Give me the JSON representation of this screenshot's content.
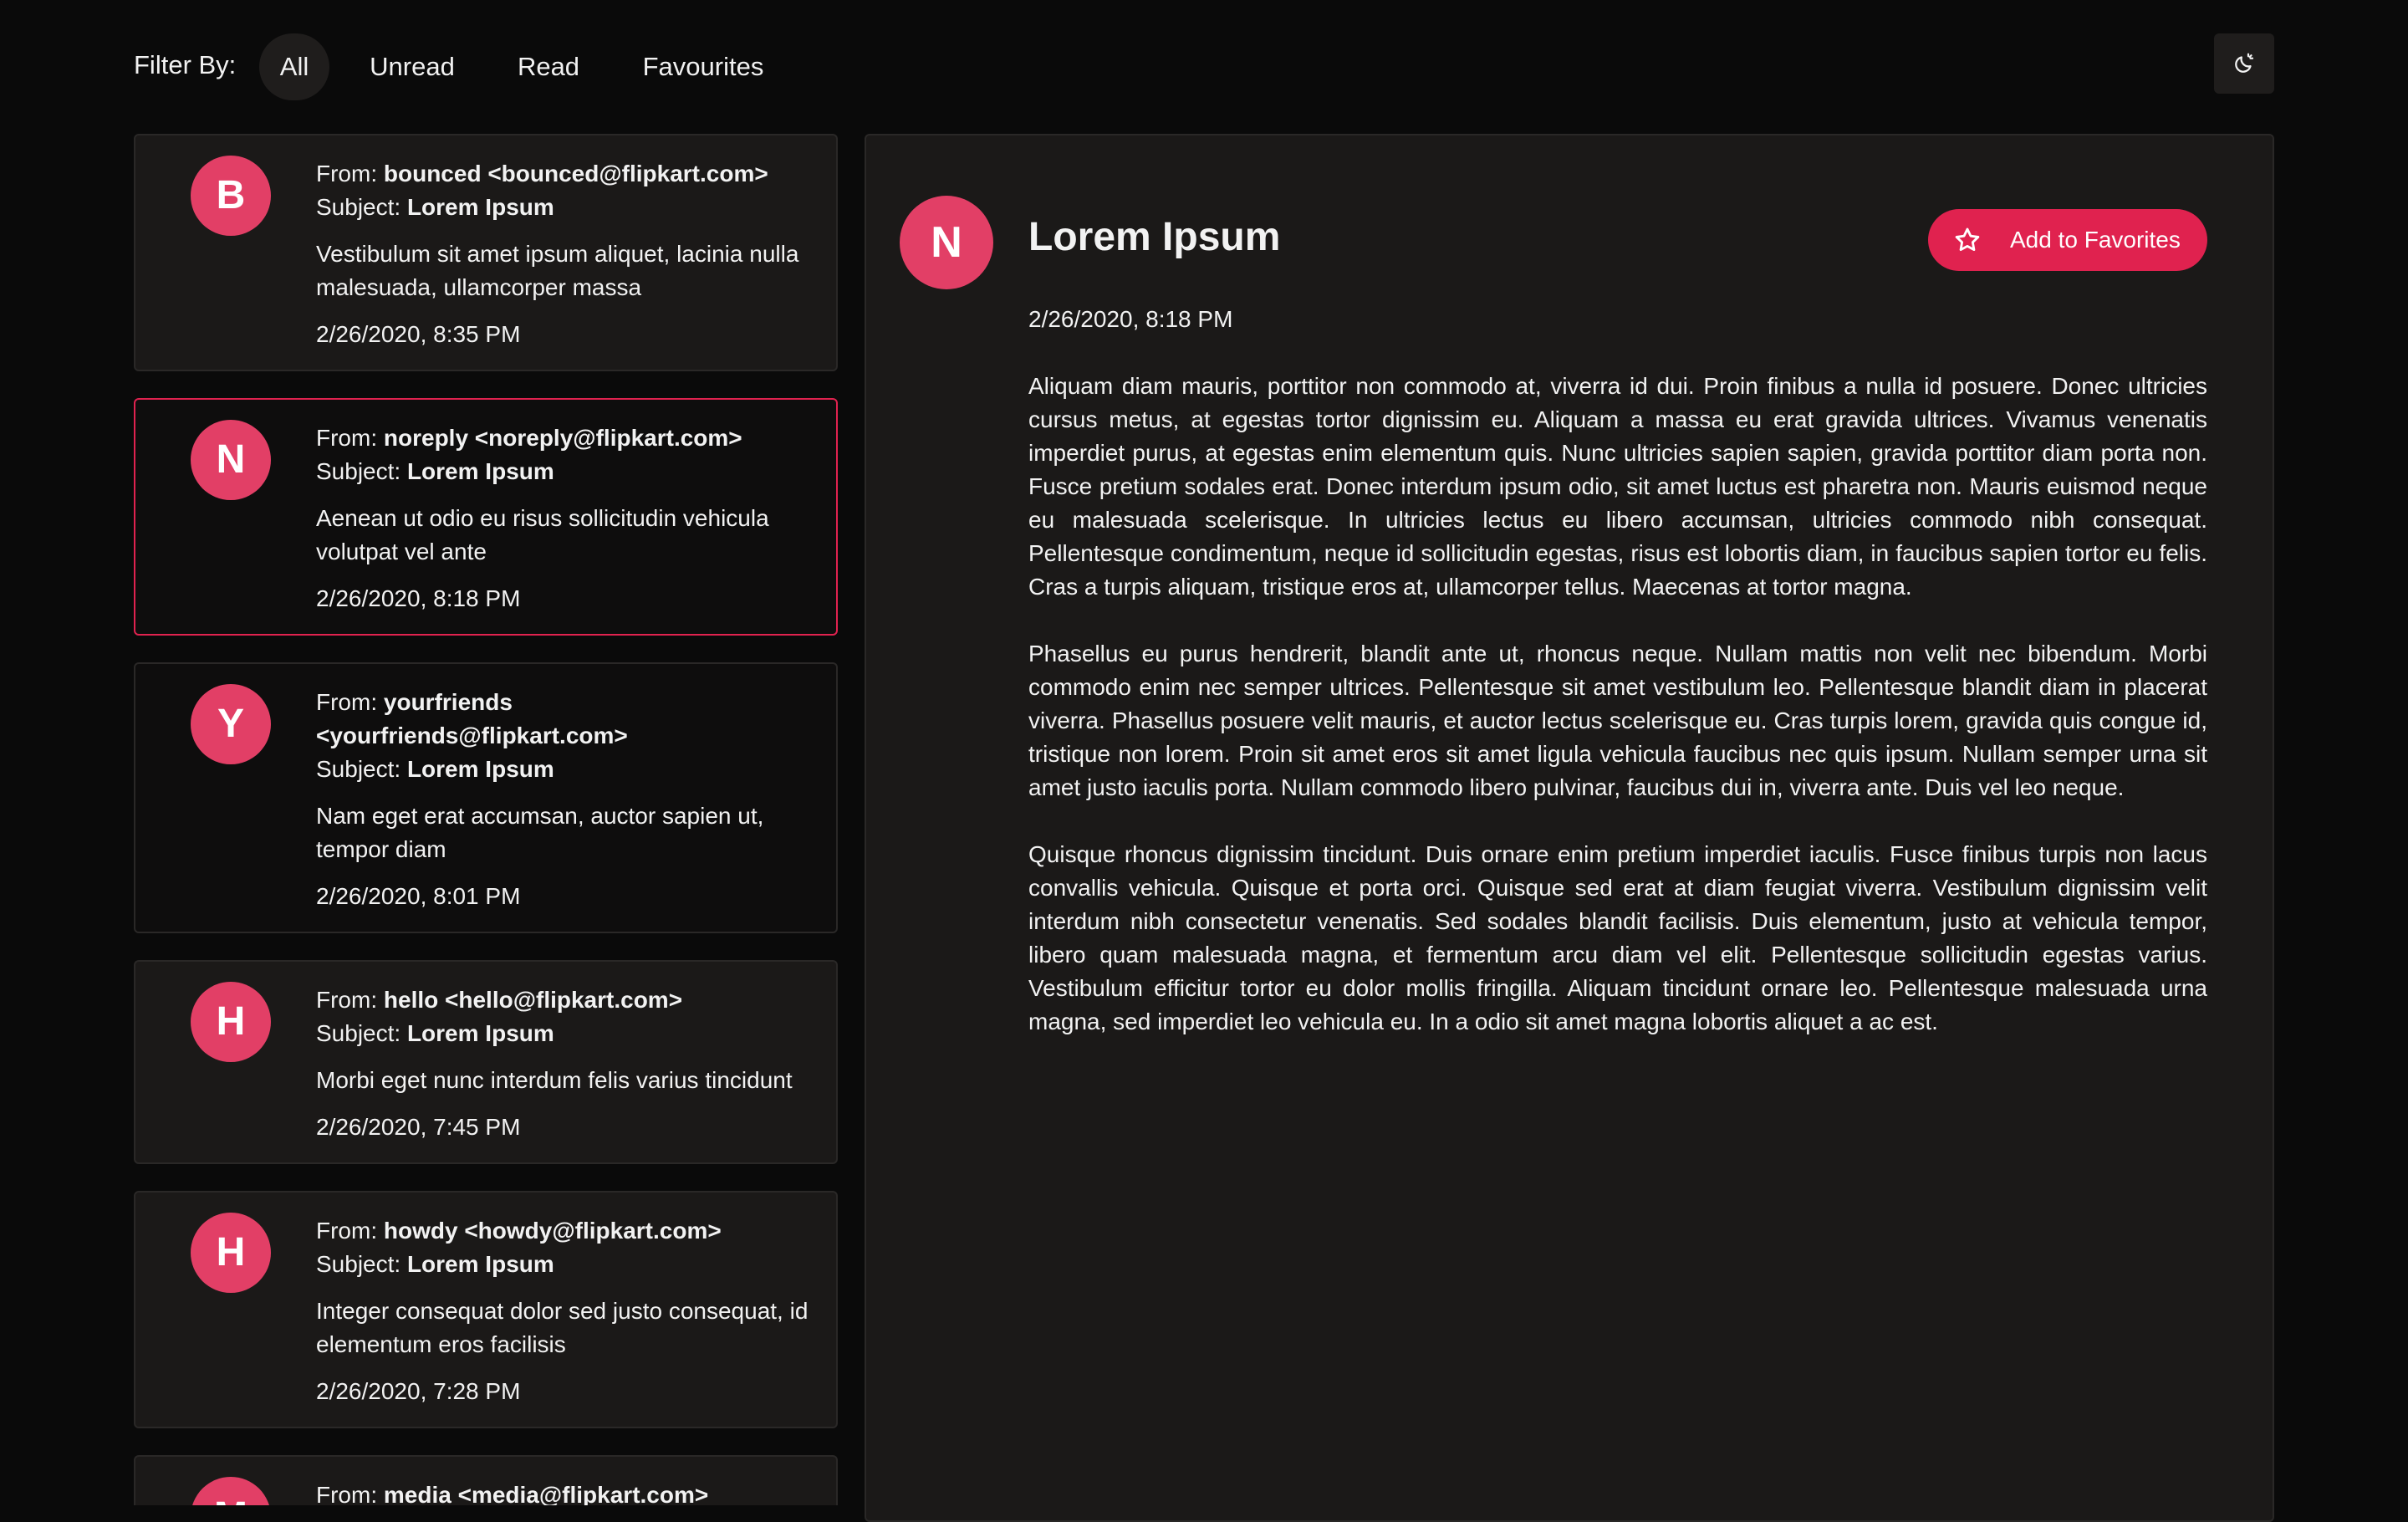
{
  "filters": {
    "label": "Filter By:",
    "options": [
      "All",
      "Unread",
      "Read",
      "Favourites"
    ],
    "active": "All"
  },
  "theme_toggle_icon": "moon-sun-icon",
  "emails": [
    {
      "initial": "B",
      "from_prefix": "From:",
      "from": "bounced <bounced@flipkart.com>",
      "subject_prefix": "Subject:",
      "subject": "Lorem Ipsum",
      "preview": "Vestibulum sit amet ipsum aliquet, lacinia nulla malesuada, ullamcorper massa",
      "date": "2/26/2020, 8:35 PM"
    },
    {
      "initial": "N",
      "from_prefix": "From:",
      "from": "noreply <noreply@flipkart.com>",
      "subject_prefix": "Subject:",
      "subject": "Lorem Ipsum",
      "preview": "Aenean ut odio eu risus sollicitudin vehicula volutpat vel ante",
      "date": "2/26/2020, 8:18 PM"
    },
    {
      "initial": "Y",
      "from_prefix": "From:",
      "from": "yourfriends <yourfriends@flipkart.com>",
      "subject_prefix": "Subject:",
      "subject": "Lorem Ipsum",
      "preview": "Nam eget erat accumsan, auctor sapien ut, tempor diam",
      "date": "2/26/2020, 8:01 PM"
    },
    {
      "initial": "H",
      "from_prefix": "From:",
      "from": "hello <hello@flipkart.com>",
      "subject_prefix": "Subject:",
      "subject": "Lorem Ipsum",
      "preview": "Morbi eget nunc interdum felis varius tincidunt",
      "date": "2/26/2020, 7:45 PM"
    },
    {
      "initial": "H",
      "from_prefix": "From:",
      "from": "howdy <howdy@flipkart.com>",
      "subject_prefix": "Subject:",
      "subject": "Lorem Ipsum",
      "preview": "Integer consequat dolor sed justo consequat, id elementum eros facilisis",
      "date": "2/26/2020, 7:28 PM"
    },
    {
      "initial": "M",
      "from_prefix": "From:",
      "from": "media <media@flipkart.com>"
    }
  ],
  "detail": {
    "initial": "N",
    "title": "Lorem Ipsum",
    "favorite_label": "Add to Favorites",
    "date": "2/26/2020, 8:18 PM",
    "paragraphs": [
      "Aliquam diam mauris, porttitor non commodo at, viverra id dui. Proin finibus a nulla id posuere. Donec ultricies cursus metus, at egestas tortor dignissim eu. Aliquam a massa eu erat gravida ultrices. Vivamus venenatis imperdiet purus, at egestas enim elementum quis. Nunc ultricies sapien sapien, gravida porttitor diam porta non. Fusce pretium sodales erat. Donec interdum ipsum odio, sit amet luctus est pharetra non. Mauris euismod neque eu malesuada scelerisque. In ultricies lectus eu libero accumsan, ultricies commodo nibh consequat. Pellentesque condimentum, neque id sollicitudin egestas, risus est lobortis diam, in faucibus sapien tortor eu felis. Cras a turpis aliquam, tristique eros at, ullamcorper tellus. Maecenas at tortor magna.",
      "Phasellus eu purus hendrerit, blandit ante ut, rhoncus neque. Nullam mattis non velit nec bibendum. Morbi commodo enim nec semper ultrices. Pellentesque sit amet vestibulum leo. Pellentesque blandit diam in placerat viverra. Phasellus posuere velit mauris, et auctor lectus scelerisque eu. Cras turpis lorem, gravida quis congue id, tristique non lorem. Proin sit amet eros sit amet ligula vehicula faucibus nec quis ipsum. Nullam semper urna sit amet justo iaculis porta. Nullam commodo libero pulvinar, faucibus dui in, viverra ante. Duis vel leo neque.",
      "Quisque rhoncus dignissim tincidunt. Duis ornare enim pretium imperdiet iaculis. Fusce finibus turpis non lacus convallis vehicula. Quisque et porta orci. Quisque sed erat at diam feugiat viverra. Vestibulum dignissim velit interdum nibh consectetur venenatis. Sed sodales blandit facilisis. Duis elementum, justo at vehicula tempor, libero quam malesuada magna, et fermentum arcu diam vel elit. Pellentesque sollicitudin egestas varius. Vestibulum efficitur tortor eu dolor mollis fringilla. Aliquam tincidunt ornare leo. Pellentesque malesuada urna magna, sed imperdiet leo vehicula eu. In a odio sit amet magna lobortis aliquet a ac est."
    ]
  },
  "colors": {
    "accent": "#e0224f",
    "avatar": "#e23f66",
    "background": "#0a0a0a",
    "card": "#1b1918"
  }
}
